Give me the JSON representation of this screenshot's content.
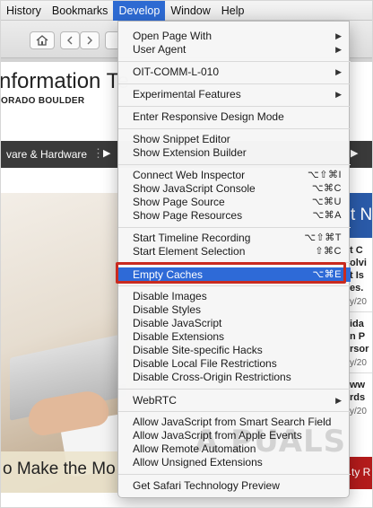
{
  "menubar": {
    "items": [
      "History",
      "Bookmarks",
      "Develop",
      "Window",
      "Help"
    ],
    "active": "Develop"
  },
  "toolbar": {
    "home_icon": "home-icon",
    "back_icon": "chevron-left-icon",
    "forward_icon": "chevron-right-icon"
  },
  "page": {
    "title_fragment": "nformation Te",
    "subtitle_light": "ORADO",
    "subtitle_bold": "BOULDER",
    "nav_label": "vare & Hardware",
    "hero_caption": "o Make the Mo",
    "side_blue": "t N",
    "side_lines_a": [
      "t C",
      "olvi",
      "t Is",
      "es."
    ],
    "side_date_a": "y/20",
    "side_lines_b": [
      "ida",
      "n P",
      "rsor"
    ],
    "side_date_b": "y/20",
    "side_lines_c": [
      "ww",
      "rds"
    ],
    "side_date_c": "y/20",
    "side_red": "ty R"
  },
  "develop_menu": {
    "items": [
      {
        "label": "Open Page With",
        "submenu": true
      },
      {
        "label": "User Agent",
        "submenu": true
      },
      {
        "label": "OIT-COMM-L-010",
        "submenu": true
      },
      {
        "label": "Experimental Features",
        "submenu": true
      },
      {
        "label": "Enter Responsive Design Mode"
      },
      {
        "label": "Show Snippet Editor"
      },
      {
        "label": "Show Extension Builder"
      },
      {
        "label": "Connect Web Inspector",
        "shortcut": "⌥⇧⌘I"
      },
      {
        "label": "Show JavaScript Console",
        "shortcut": "⌥⌘C"
      },
      {
        "label": "Show Page Source",
        "shortcut": "⌥⌘U"
      },
      {
        "label": "Show Page Resources",
        "shortcut": "⌥⌘A"
      },
      {
        "label": "Start Timeline Recording",
        "shortcut": "⌥⇧⌘T"
      },
      {
        "label": "Start Element Selection",
        "shortcut": "⇧⌘C"
      },
      {
        "label": "Empty Caches",
        "shortcut": "⌥⌘E",
        "highlighted": true
      },
      {
        "label": "Disable Images"
      },
      {
        "label": "Disable Styles"
      },
      {
        "label": "Disable JavaScript"
      },
      {
        "label": "Disable Extensions"
      },
      {
        "label": "Disable Site-specific Hacks"
      },
      {
        "label": "Disable Local File Restrictions"
      },
      {
        "label": "Disable Cross-Origin Restrictions"
      },
      {
        "label": "WebRTC",
        "submenu": true
      },
      {
        "label": "Allow JavaScript from Smart Search Field"
      },
      {
        "label": "Allow JavaScript from Apple Events"
      },
      {
        "label": "Allow Remote Automation"
      },
      {
        "label": "Allow Unsigned Extensions"
      },
      {
        "label": "Get Safari Technology Preview"
      }
    ],
    "submenu_icon": "chevron-right-icon"
  },
  "watermark": "A PUALS",
  "colors": {
    "menu_highlight": "#2e6ad7",
    "callout_border": "#c92a1f",
    "nav_bar": "#3a3a3a"
  }
}
